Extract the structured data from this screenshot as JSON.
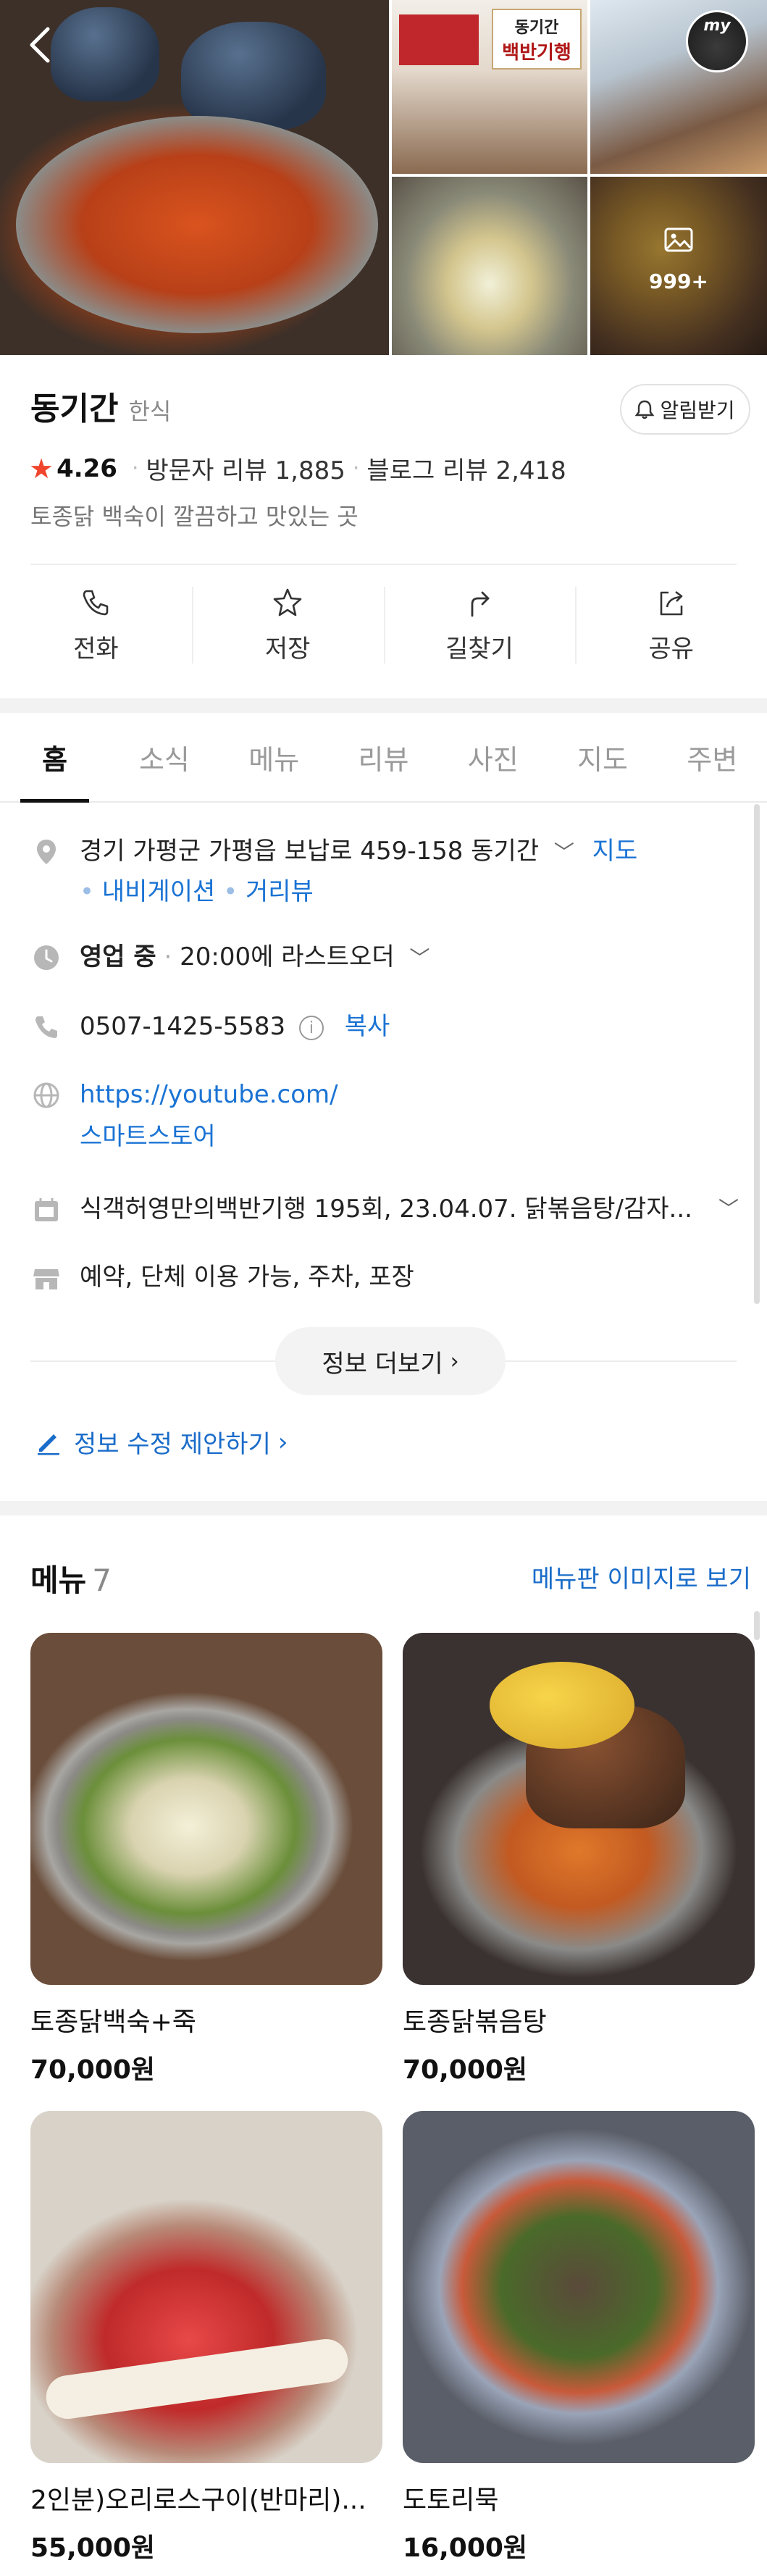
{
  "place": {
    "name": "동기간",
    "category": "한식",
    "alarm_label": "알림받기",
    "rating": "4.26",
    "visitor_reviews": "방문자 리뷰 1,885",
    "blog_reviews": "블로그 리뷰 2,418",
    "description": "토종닭 백숙이 깔끔하고 맛있는 곳"
  },
  "hero": {
    "photo_count": "999+",
    "my_badge": "my",
    "tv_banner_top": "동기간",
    "tv_banner_bottom": "백반기행"
  },
  "actions": [
    {
      "label": "전화",
      "icon": "phone-icon"
    },
    {
      "label": "저장",
      "icon": "star-icon"
    },
    {
      "label": "길찾기",
      "icon": "directions-icon"
    },
    {
      "label": "공유",
      "icon": "share-icon"
    }
  ],
  "tabs": [
    "홈",
    "소식",
    "메뉴",
    "리뷰",
    "사진",
    "지도",
    "주변"
  ],
  "info": {
    "address": "경기 가평군 가평읍 보납로 459-158 동기간",
    "map_link": "지도",
    "navigation": "내비게이션",
    "street_view": "거리뷰",
    "status": "영업 중",
    "last_order": "20:00에 라스트오더",
    "phone": "0507-1425-5583",
    "copy": "복사",
    "website": "https://youtube.com/",
    "smartstore": "스마트스토어",
    "media": "식객허영만의백반기행 195회, 23.04.07. 닭볶음탕/감자...",
    "amenities": "예약, 단체 이용 가능, 주차, 포장",
    "more_info": "정보 더보기",
    "edit_suggest": "정보 수정 제안하기"
  },
  "menu": {
    "title": "메뉴",
    "count": "7",
    "image_link": "메뉴판 이미지로 보기",
    "items": [
      {
        "name": "토종닭백숙+죽",
        "price": "70,000원"
      },
      {
        "name": "토종닭볶음탕",
        "price": "70,000원"
      },
      {
        "name": "2인분)오리로스구이(반마리)...",
        "price": "55,000원"
      },
      {
        "name": "도토리묵",
        "price": "16,000원"
      }
    ]
  },
  "colors": {
    "accent_blue": "#1a6cc9",
    "star_red": "#f0442c",
    "section_gap": "#f2f2f2"
  }
}
